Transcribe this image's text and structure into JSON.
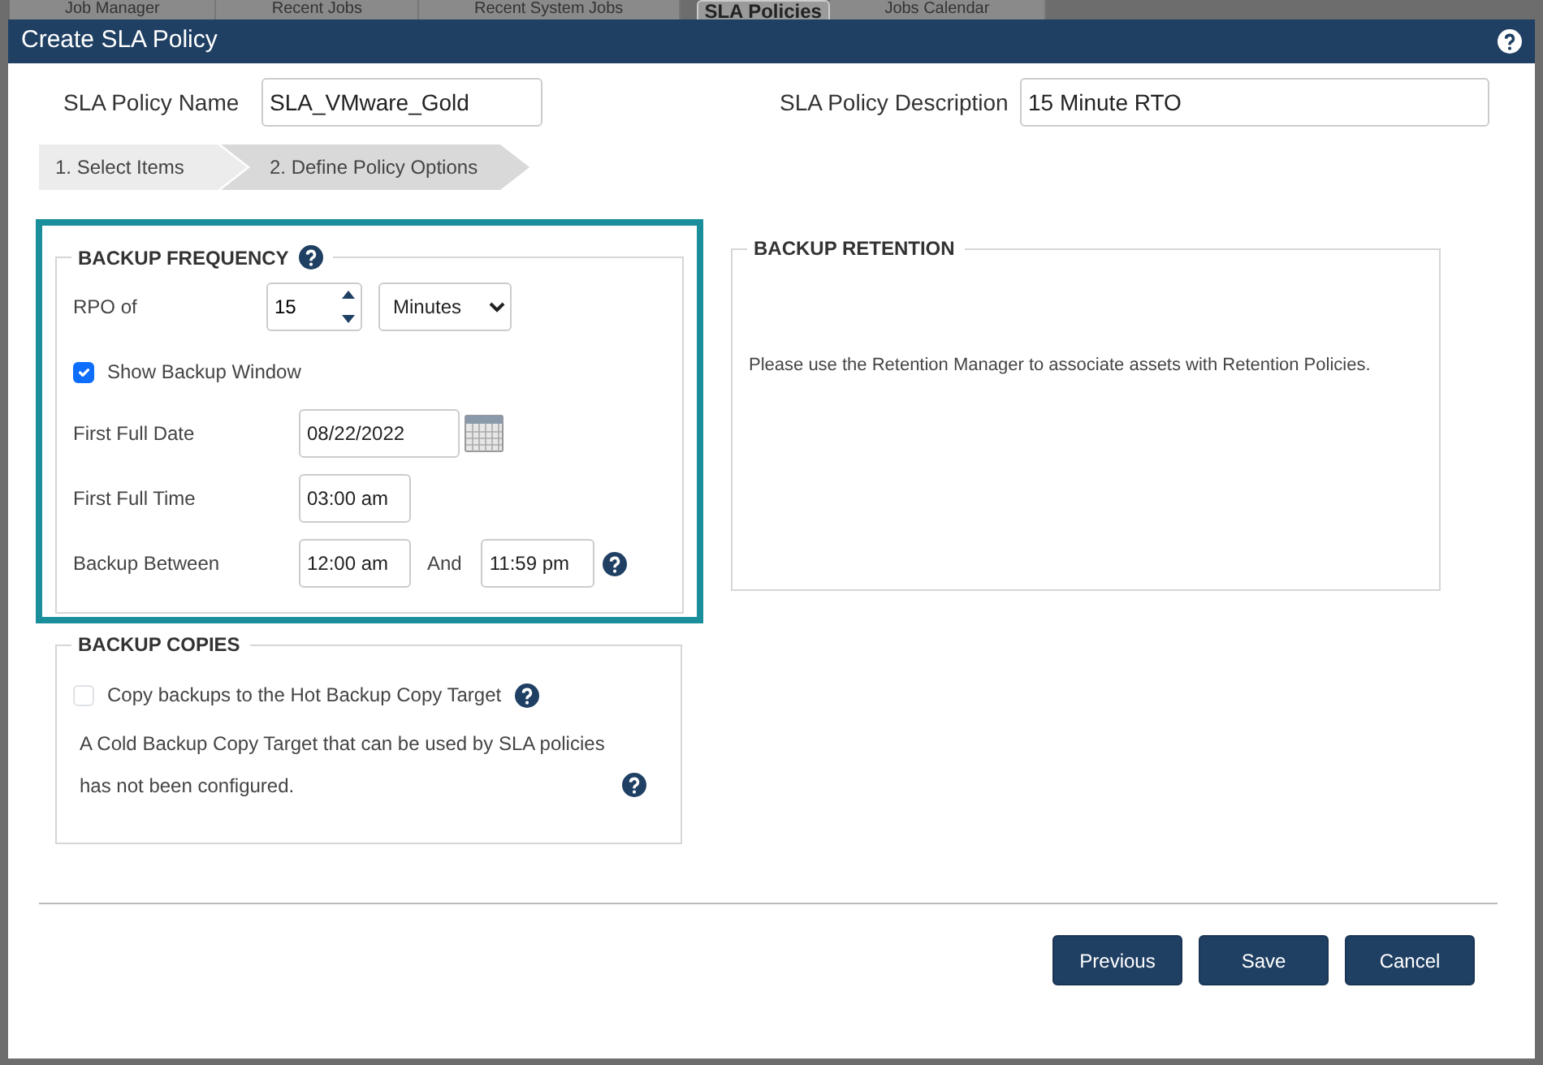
{
  "background_tabs": [
    {
      "label": "Job Manager",
      "selected": false
    },
    {
      "label": "Recent Jobs",
      "selected": false
    },
    {
      "label": "Recent System Jobs",
      "selected": false
    },
    {
      "label": "SLA Policies",
      "selected": true
    },
    {
      "label": "Jobs Calendar",
      "selected": false
    }
  ],
  "dialog": {
    "title": "Create SLA Policy"
  },
  "policy_name": {
    "label": "SLA Policy Name",
    "value": "SLA_VMware_Gold"
  },
  "policy_description": {
    "label": "SLA Policy Description",
    "value": "15 Minute RTO"
  },
  "steps": [
    {
      "label": "1. Select Items",
      "selected": false
    },
    {
      "label": "2. Define Policy Options",
      "selected": true
    }
  ],
  "backup_frequency": {
    "title": "BACKUP FREQUENCY",
    "highlighted": true,
    "rpo": {
      "label": "RPO of",
      "value": "15",
      "unit": "Minutes"
    },
    "show_backup_window": {
      "label": "Show Backup Window",
      "checked": true
    },
    "first_full_date": {
      "label": "First Full Date",
      "value": "08/22/2022"
    },
    "first_full_time": {
      "label": "First Full Time",
      "value": "03:00 am"
    },
    "backup_between": {
      "label": "Backup Between",
      "start": "12:00 am",
      "joiner": "And",
      "end": "11:59 pm"
    }
  },
  "backup_retention": {
    "title": "BACKUP RETENTION",
    "message": "Please use the Retention Manager to associate assets with Retention Policies."
  },
  "backup_copies": {
    "title": "BACKUP COPIES",
    "hot_copy": {
      "label": "Copy backups to the Hot Backup Copy Target",
      "checked": false
    },
    "cold_copy_message": "A Cold Backup Copy Target that can be used by SLA policies has not been configured."
  },
  "buttons": [
    {
      "label": "Previous"
    },
    {
      "label": "Save"
    },
    {
      "label": "Cancel"
    }
  ]
}
